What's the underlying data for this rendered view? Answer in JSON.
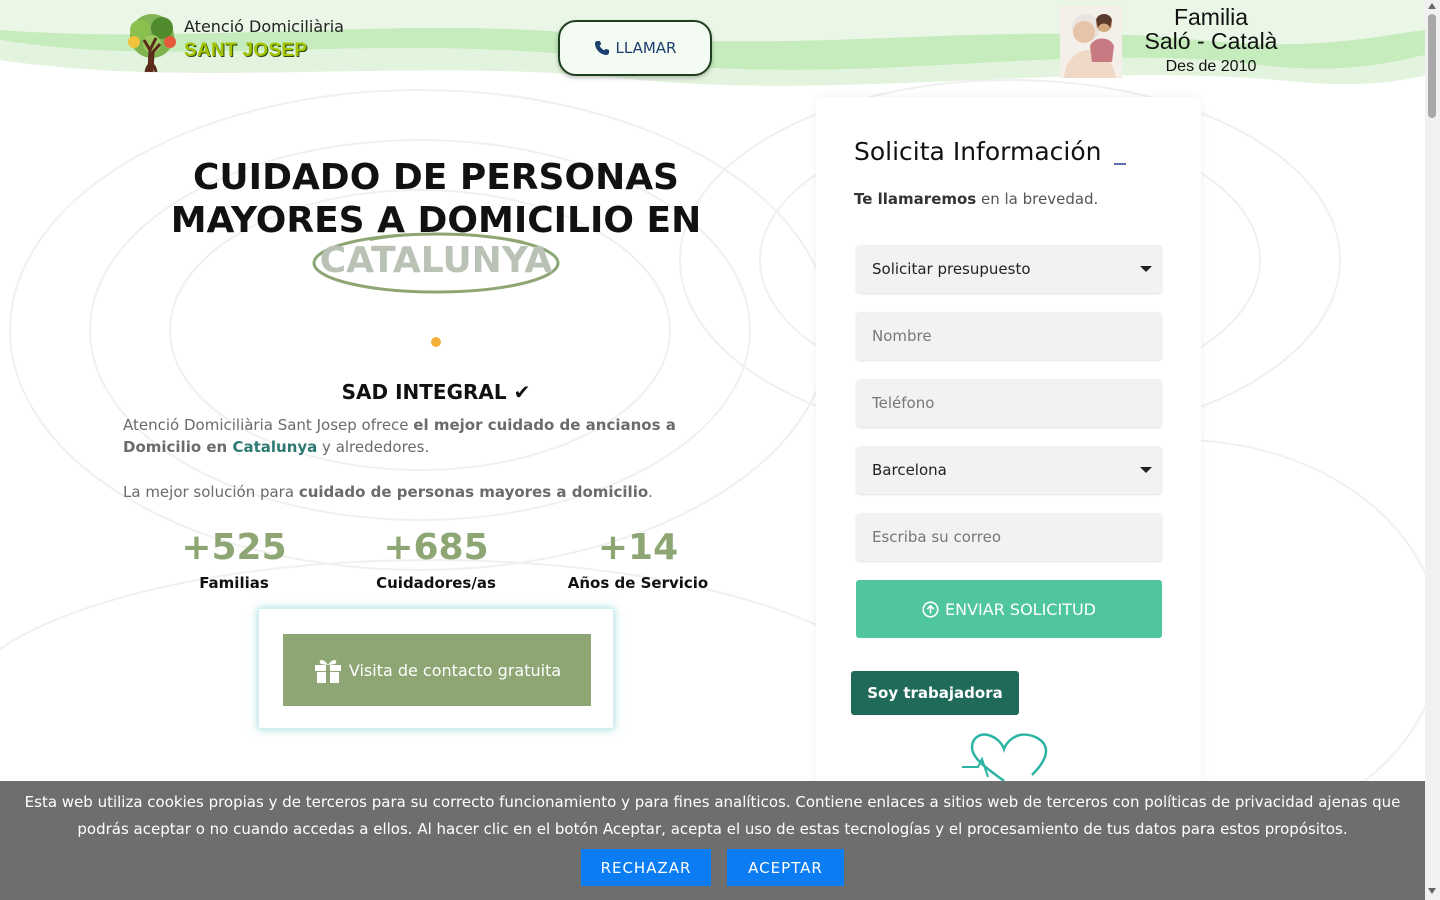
{
  "header": {
    "logo": {
      "line1": "Atenció Domiciliària",
      "line2": "SANT JOSEP"
    },
    "call_label": "LLAMAR",
    "family": {
      "line1": "Familia",
      "line2": "Saló - Català",
      "line3": "Des de 2010"
    }
  },
  "hero": {
    "title_line1": "CUIDADO DE PERSONAS",
    "title_line2": "MAYORES A DOMICILIO EN",
    "highlight": "CATALUNYA",
    "section_title": "SAD INTEGRAL",
    "check_glyph": "✔",
    "intro": {
      "p1_a": "Atenció Domiciliària Sant Josep ofrece ",
      "p1_b": "el mejor cuidado de ancianos a Domicilio en ",
      "p1_c": "Catalunya",
      "p1_d": " y alrededores.",
      "p2_a": "La mejor solución para ",
      "p2_b": "cuidado de personas mayores a domicilio",
      "p2_c": "."
    },
    "stats": [
      {
        "value": "+525",
        "label": "Familias"
      },
      {
        "value": "+685",
        "label": "Cuidadores/as"
      },
      {
        "value": "+14",
        "label": "Años de Servicio"
      }
    ],
    "visit_button": "Visita de contacto gratuita"
  },
  "form": {
    "title": "Solicita Información",
    "subtitle_bold": "Te llamaremos",
    "subtitle_rest": " en la brevedad.",
    "request_type": "Solicitar presupuesto",
    "name_placeholder": "Nombre",
    "phone_placeholder": "Teléfono",
    "province": "Barcelona",
    "email_placeholder": "Escriba su correo",
    "submit_label": "ENVIAR SOLICITUD",
    "worker_label": "Soy trabajadora"
  },
  "cookies": {
    "text": "Esta web utiliza cookies propias y de terceros para su correcto funcionamiento y para fines analíticos. Contiene enlaces a sitios web de terceros con políticas de privacidad ajenas que podrás aceptar o no cuando accedas a ellos. Al hacer clic en el botón Aceptar, acepta el uso de estas tecnologías y el procesamiento de tus datos para estos propósitos.",
    "reject": "RECHAZAR",
    "accept": "ACEPTAR"
  },
  "colors": {
    "accent_green": "#8ea674",
    "submit_green": "#4fc5a0",
    "worker_green": "#1f6a58",
    "cookie_bg": "#6e6e6e",
    "cookie_button": "#0b7cf2",
    "header_wave": "#bfe6b5",
    "logo_green": "#a4c400"
  },
  "icons": {
    "call": "phone-icon",
    "visit": "gift-icon",
    "submit": "arrow-up-circle-icon",
    "check": "check-icon",
    "decoration": "heart-icon",
    "logo": "tree-icon"
  }
}
